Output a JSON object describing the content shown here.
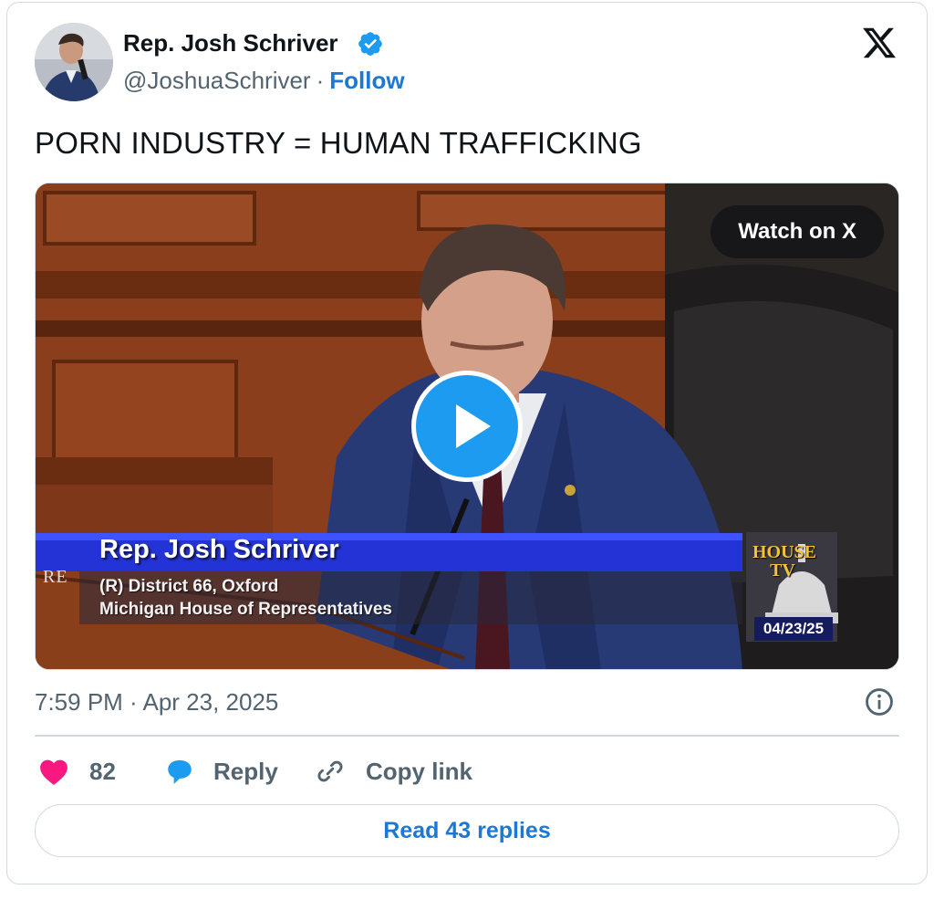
{
  "author": {
    "name": "Rep. Josh Schriver",
    "handle": "@JoshuaSchriver",
    "separator": "·",
    "follow_label": "Follow",
    "verified": true
  },
  "tweet": {
    "text": "PORN INDUSTRY = HUMAN TRAFFICKING",
    "timestamp": "7:59 PM · Apr 23, 2025"
  },
  "media": {
    "watch_label": "Watch on X",
    "lower_third": {
      "name": "Rep. Josh Schriver",
      "line1": "(R) District 66, Oxford",
      "line2": "Michigan House of Representatives",
      "partial_text": "RE"
    },
    "house_tv": {
      "title_line1": "HOUSE",
      "title_line2": "TV",
      "date": "04/23/25"
    }
  },
  "actions": {
    "like_count": "82",
    "reply_label": "Reply",
    "copy_label": "Copy link"
  },
  "footer": {
    "read_replies_label": "Read 43 replies"
  },
  "colors": {
    "link_blue": "#1d78d3",
    "like_pink": "#f91880",
    "reply_blue": "#1d9bf0",
    "verified_blue": "#1d9bf0",
    "muted_gray": "#536471",
    "border": "#cfd9de"
  },
  "icons": [
    "verified-badge-icon",
    "x-logo-icon",
    "play-icon",
    "heart-icon",
    "reply-bubble-icon",
    "link-icon",
    "info-icon"
  ]
}
